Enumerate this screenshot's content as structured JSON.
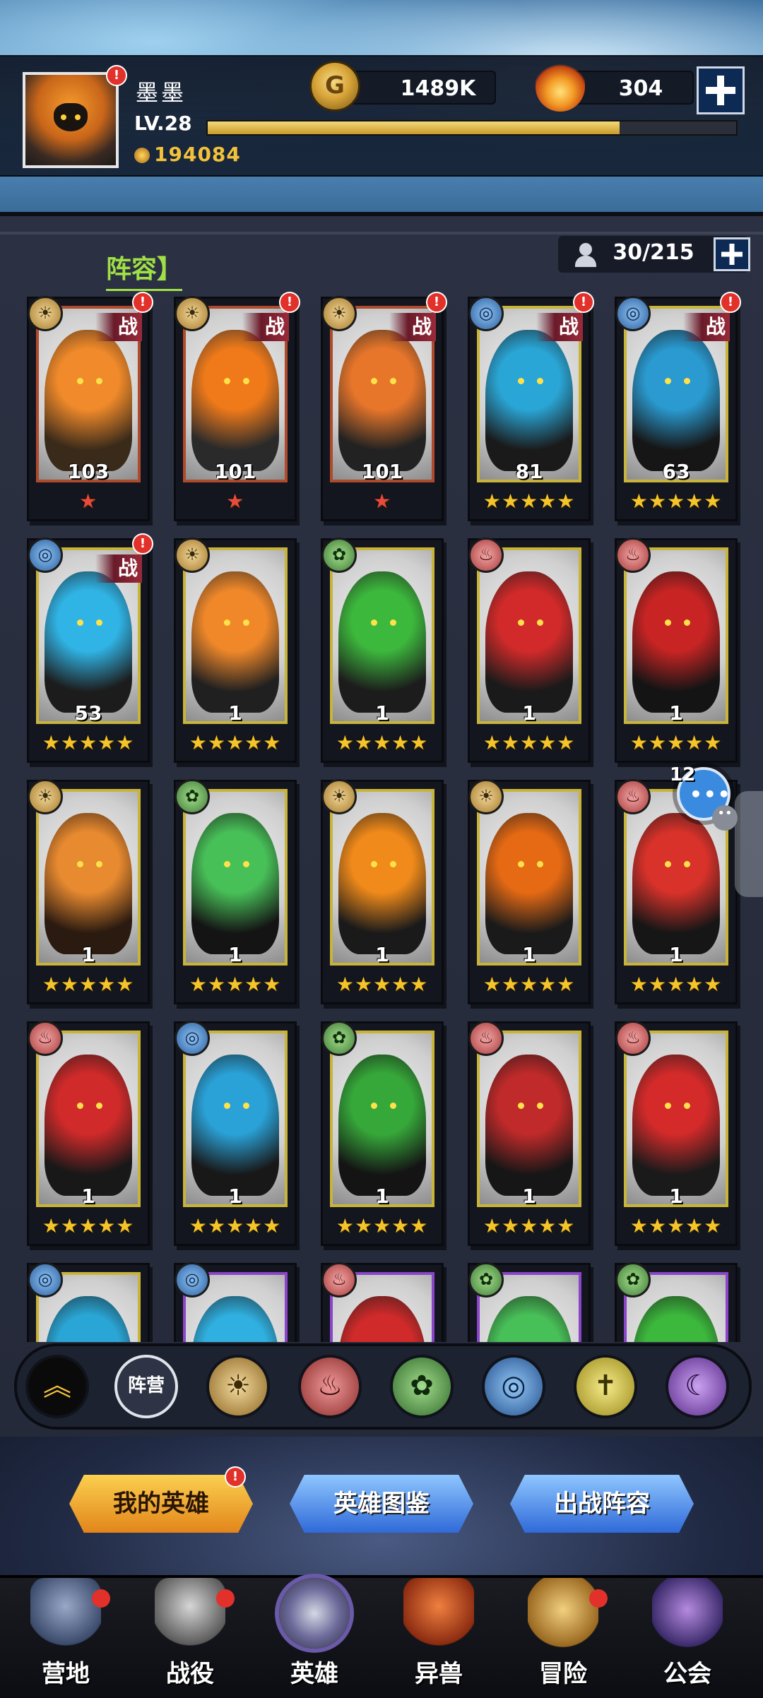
{
  "player": {
    "name": "墨墨",
    "level": "LV.28",
    "xp_fraction": 0.78,
    "power": "194084",
    "avatar_alert": "!"
  },
  "resources": {
    "gold": "1489K",
    "gems": "304",
    "gold_icon": "gold-coin-icon",
    "gem_icon": "fire-gem-icon"
  },
  "roster": {
    "tab_label": "阵容】",
    "count": "30/215"
  },
  "heroes": [
    {
      "level": "103",
      "stars": "★",
      "star_color": "red",
      "faction": "sun",
      "battle": "战",
      "alert": "!",
      "frame": "red",
      "art": [
        "#f08a2a",
        "#3a2a1a"
      ]
    },
    {
      "level": "101",
      "stars": "★",
      "star_color": "red",
      "faction": "sun",
      "battle": "战",
      "alert": "!",
      "frame": "red",
      "art": [
        "#f07a1a",
        "#2a2a2a"
      ]
    },
    {
      "level": "101",
      "stars": "★",
      "star_color": "red",
      "faction": "sun",
      "battle": "战",
      "alert": "!",
      "frame": "red",
      "art": [
        "#e8762a",
        "#222222"
      ]
    },
    {
      "level": "81",
      "stars": "★★★★★",
      "star_color": "gold",
      "faction": "water",
      "battle": "战",
      "alert": "!",
      "frame": "gold",
      "art": [
        "#2aa6d6",
        "#1a1a1a"
      ]
    },
    {
      "level": "63",
      "stars": "★★★★★",
      "star_color": "gold",
      "faction": "water",
      "battle": "战",
      "alert": "!",
      "frame": "gold",
      "art": [
        "#2a9ad0",
        "#161616"
      ]
    },
    {
      "level": "53",
      "stars": "★★★★★",
      "star_color": "gold",
      "faction": "water",
      "battle": "战",
      "alert": "!",
      "frame": "gold",
      "art": [
        "#30b4e6",
        "#1c1c1c"
      ]
    },
    {
      "level": "1",
      "stars": "★★★★★",
      "star_color": "gold",
      "faction": "sun",
      "battle": "",
      "alert": "",
      "frame": "gold",
      "art": [
        "#f0882a",
        "#202020"
      ]
    },
    {
      "level": "1",
      "stars": "★★★★★",
      "star_color": "gold",
      "faction": "nature",
      "battle": "",
      "alert": "",
      "frame": "gold",
      "art": [
        "#3cb83c",
        "#1c1c1c"
      ]
    },
    {
      "level": "1",
      "stars": "★★★★★",
      "star_color": "gold",
      "faction": "fire",
      "battle": "",
      "alert": "",
      "frame": "gold",
      "art": [
        "#d22a2a",
        "#1a1a1a"
      ]
    },
    {
      "level": "1",
      "stars": "★★★★★",
      "star_color": "gold",
      "faction": "fire",
      "battle": "",
      "alert": "",
      "frame": "gold",
      "art": [
        "#c82424",
        "#141414"
      ]
    },
    {
      "level": "1",
      "stars": "★★★★★",
      "star_color": "gold",
      "faction": "sun",
      "battle": "",
      "alert": "",
      "frame": "gold",
      "art": [
        "#e88a30",
        "#2a1a10"
      ]
    },
    {
      "level": "1",
      "stars": "★★★★★",
      "star_color": "gold",
      "faction": "nature",
      "battle": "",
      "alert": "",
      "frame": "gold",
      "art": [
        "#48c058",
        "#141414"
      ]
    },
    {
      "level": "1",
      "stars": "★★★★★",
      "star_color": "gold",
      "faction": "sun",
      "battle": "",
      "alert": "",
      "frame": "gold",
      "art": [
        "#f08a1a",
        "#1a1a1a"
      ]
    },
    {
      "level": "1",
      "stars": "★★★★★",
      "star_color": "gold",
      "faction": "sun",
      "battle": "",
      "alert": "",
      "frame": "gold",
      "art": [
        "#e66a14",
        "#1a1a1a"
      ]
    },
    {
      "level": "1",
      "stars": "★★★★★",
      "star_color": "gold",
      "faction": "fire",
      "battle": "",
      "alert": "",
      "frame": "gold",
      "art": [
        "#d8322a",
        "#161616"
      ]
    },
    {
      "level": "1",
      "stars": "★★★★★",
      "star_color": "gold",
      "faction": "fire",
      "battle": "",
      "alert": "",
      "frame": "gold",
      "art": [
        "#d02a2a",
        "#181818"
      ]
    },
    {
      "level": "1",
      "stars": "★★★★★",
      "star_color": "gold",
      "faction": "water",
      "battle": "",
      "alert": "",
      "frame": "gold",
      "art": [
        "#2aa2d8",
        "#181818"
      ]
    },
    {
      "level": "1",
      "stars": "★★★★★",
      "star_color": "gold",
      "faction": "nature",
      "battle": "",
      "alert": "",
      "frame": "gold",
      "art": [
        "#36a83a",
        "#141414"
      ]
    },
    {
      "level": "1",
      "stars": "★★★★★",
      "star_color": "gold",
      "faction": "fire",
      "battle": "",
      "alert": "",
      "frame": "gold",
      "art": [
        "#c02a2a",
        "#161616"
      ]
    },
    {
      "level": "1",
      "stars": "★★★★★",
      "star_color": "gold",
      "faction": "fire",
      "battle": "",
      "alert": "",
      "frame": "gold",
      "art": [
        "#d42a2a",
        "#1a1a1a"
      ]
    },
    {
      "level": "",
      "stars": "",
      "star_color": "gold",
      "faction": "water",
      "battle": "",
      "alert": "",
      "frame": "gold",
      "art": [
        "#2aa6d6",
        "#1a1a1a"
      ]
    },
    {
      "level": "",
      "stars": "",
      "star_color": "gold",
      "faction": "water",
      "battle": "",
      "alert": "",
      "frame": "purple",
      "art": [
        "#30b0e0",
        "#1a1a1a"
      ]
    },
    {
      "level": "",
      "stars": "",
      "star_color": "gold",
      "faction": "fire",
      "battle": "",
      "alert": "",
      "frame": "purple",
      "art": [
        "#d02a2a",
        "#1a1a1a"
      ]
    },
    {
      "level": "",
      "stars": "",
      "star_color": "gold",
      "faction": "nature",
      "battle": "",
      "alert": "",
      "frame": "purple",
      "art": [
        "#48c058",
        "#1a1a1a"
      ]
    },
    {
      "level": "",
      "stars": "",
      "star_color": "gold",
      "faction": "nature",
      "battle": "",
      "alert": "",
      "frame": "purple",
      "art": [
        "#3cb83c",
        "#1a1a1a"
      ]
    }
  ],
  "faction_icons": {
    "sun": "☀",
    "water": "◎",
    "nature": "✿",
    "fire": "♨"
  },
  "chat": {
    "count": "12",
    "dots": "•••",
    "mini_dots": "••"
  },
  "filters": {
    "up_icon": "︽",
    "camp_label": "阵营",
    "sun": "☀",
    "fire": "♨",
    "nature": "✿",
    "water": "◎",
    "holy": "✝",
    "dark": "☾"
  },
  "tabs": {
    "my_heroes": "我的英雄",
    "my_heroes_alert": "!",
    "hero_guide": "英雄图鉴",
    "battle_lineup": "出战阵容"
  },
  "nav": [
    {
      "label": "营地",
      "icon": "camp-icon",
      "alert": true
    },
    {
      "label": "战役",
      "icon": "crossed-swords-icon",
      "alert": true
    },
    {
      "label": "英雄",
      "icon": "helmet-icon",
      "alert": false,
      "active": true
    },
    {
      "label": "异兽",
      "icon": "beast-icon",
      "alert": false
    },
    {
      "label": "冒险",
      "icon": "compass-icon",
      "alert": true
    },
    {
      "label": "公会",
      "icon": "guild-scroll-icon",
      "alert": false
    }
  ],
  "colors": {
    "accent_green": "#9fe046",
    "gold": "#f3c23a",
    "alert_red": "#e2302b"
  }
}
